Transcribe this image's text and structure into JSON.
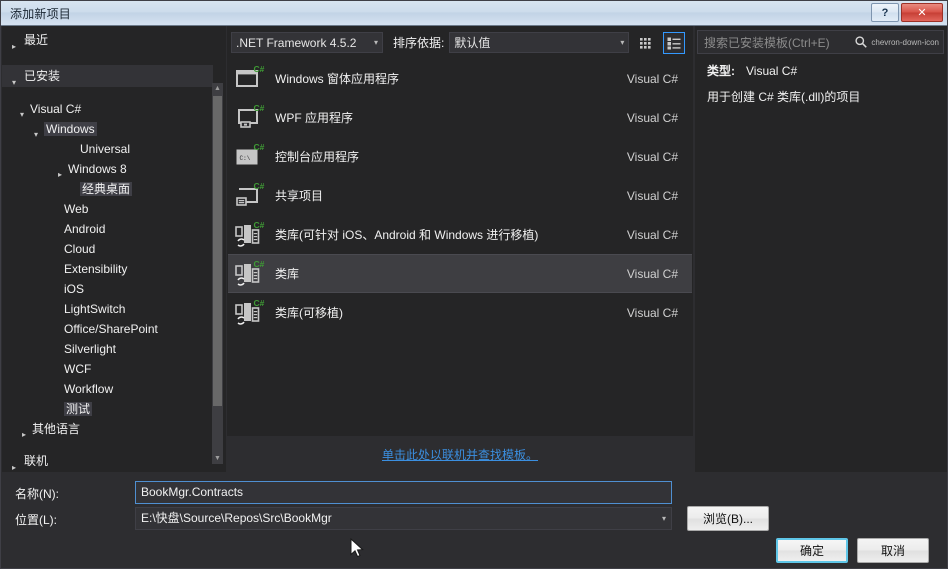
{
  "window": {
    "title": "添加新项目",
    "help_button": "?",
    "close_button": "✕",
    "help_icon": "question-mark-icon",
    "close_icon": "close-x-icon"
  },
  "sidebar": {
    "groups": [
      {
        "label": "最近",
        "state": "collapsed",
        "indent": 6,
        "selected": false
      },
      {
        "label": "已安装",
        "state": "expanded",
        "indent": 6,
        "selected": true
      }
    ],
    "items": [
      {
        "label": "Visual C#",
        "state": "expanded",
        "indent": 14,
        "boxed": false
      },
      {
        "label": "Windows",
        "state": "expanded",
        "indent": 28,
        "boxed": true
      },
      {
        "label": "Universal",
        "state": "leaf",
        "indent": 64,
        "boxed": false
      },
      {
        "label": "Windows 8",
        "state": "collapsed",
        "indent": 52,
        "boxed": false
      },
      {
        "label": "经典桌面",
        "state": "leaf",
        "indent": 64,
        "boxed": true
      },
      {
        "label": "Web",
        "state": "leaf",
        "indent": 48,
        "boxed": false
      },
      {
        "label": "Android",
        "state": "leaf",
        "indent": 48,
        "boxed": false
      },
      {
        "label": "Cloud",
        "state": "leaf",
        "indent": 48,
        "boxed": false
      },
      {
        "label": "Extensibility",
        "state": "leaf",
        "indent": 48,
        "boxed": false
      },
      {
        "label": "iOS",
        "state": "leaf",
        "indent": 48,
        "boxed": false
      },
      {
        "label": "LightSwitch",
        "state": "leaf",
        "indent": 48,
        "boxed": false
      },
      {
        "label": "Office/SharePoint",
        "state": "leaf",
        "indent": 48,
        "boxed": false
      },
      {
        "label": "Silverlight",
        "state": "leaf",
        "indent": 48,
        "boxed": false
      },
      {
        "label": "WCF",
        "state": "leaf",
        "indent": 48,
        "boxed": false
      },
      {
        "label": "Workflow",
        "state": "leaf",
        "indent": 48,
        "boxed": false
      },
      {
        "label": "测试",
        "state": "leaf",
        "indent": 48,
        "boxed": true
      },
      {
        "label": "其他语言",
        "state": "collapsed",
        "indent": 16,
        "boxed": false
      }
    ],
    "footer_group": {
      "label": "联机",
      "state": "collapsed",
      "indent": 6
    },
    "scrollbar": {
      "up_arrow": "▲",
      "down_arrow": "▼"
    }
  },
  "toolbar": {
    "framework": ".NET Framework 4.5.2",
    "framework_caret": "▾",
    "sort_label": "排序依据:",
    "sort_value": "默认值",
    "sort_caret": "▾",
    "view_medium_icon": "grid-view-icon",
    "view_list_icon": "list-view-icon",
    "active_view": "list"
  },
  "templates": {
    "language_column": "Visual C#",
    "items": [
      {
        "name": "Windows 窗体应用程序",
        "language": "Visual C#",
        "icon": "winforms-icon",
        "selected": false
      },
      {
        "name": "WPF 应用程序",
        "language": "Visual C#",
        "icon": "wpf-icon",
        "selected": false
      },
      {
        "name": "控制台应用程序",
        "language": "Visual C#",
        "icon": "console-icon",
        "selected": false
      },
      {
        "name": "共享项目",
        "language": "Visual C#",
        "icon": "shared-project-icon",
        "selected": false
      },
      {
        "name": "类库(可针对 iOS、Android 和 Windows 进行移植)",
        "language": "Visual C#",
        "icon": "portable-class-library-icon",
        "selected": false
      },
      {
        "name": "类库",
        "language": "Visual C#",
        "icon": "class-library-icon",
        "selected": true
      },
      {
        "name": "类库(可移植)",
        "language": "Visual C#",
        "icon": "portable-class-library-icon",
        "selected": false
      }
    ],
    "online_link": "单击此处以联机并查找模板。"
  },
  "search": {
    "placeholder": "搜索已安装模板(Ctrl+E)",
    "search_icon": "magnifier-icon",
    "dropdown_icon": "chevron-down-icon"
  },
  "info": {
    "type_label": "类型:",
    "type_value": "Visual C#",
    "description": "用于创建 C# 类库(.dll)的项目"
  },
  "form": {
    "name_label": "名称(N):",
    "name_value": "BookMgr.Contracts",
    "location_label": "位置(L):",
    "location_value": "E:\\快盘\\Source\\Repos\\Src\\BookMgr",
    "location_caret": "▾",
    "browse_button": "浏览(B)...",
    "ok_button": "确定",
    "cancel_button": "取消"
  },
  "colors": {
    "dialog_bg": "#2d2d30",
    "pane_bg": "#252526",
    "selection_bg": "#3e3e42",
    "accent_link": "#3b8fe0",
    "focus_border": "#5fc6e8",
    "csharp_badge": "#3f9c35",
    "titlebar": "#cddcec",
    "close_button": "#d9544a"
  }
}
